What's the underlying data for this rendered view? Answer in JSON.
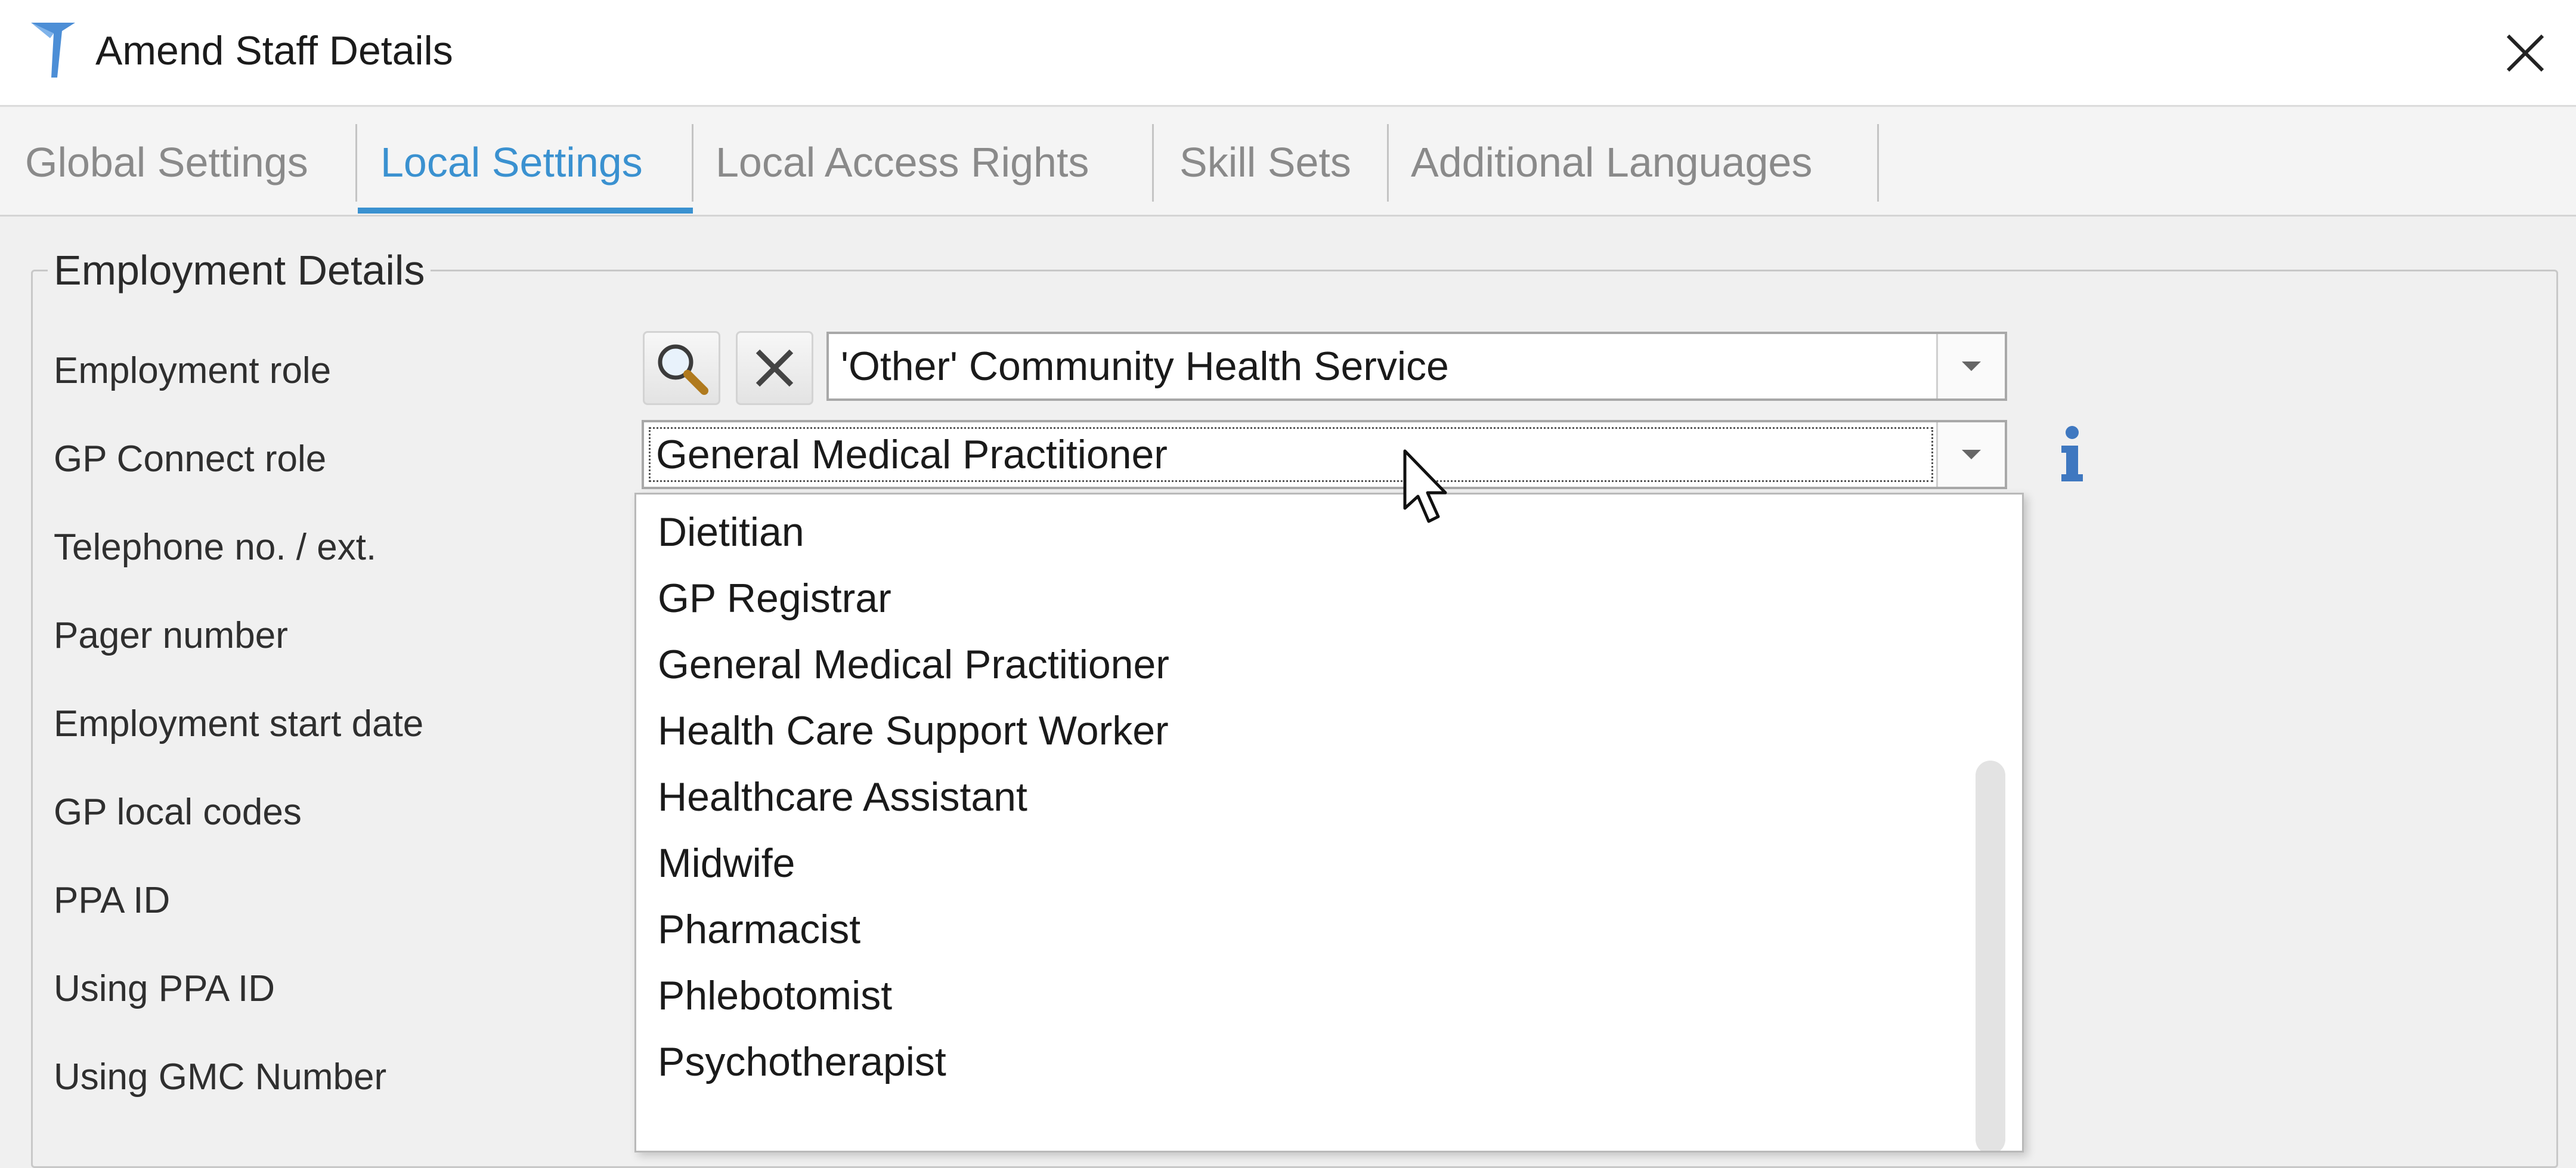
{
  "window": {
    "title": "Amend Staff Details",
    "icon": "app-logo-icon",
    "close_icon": "close-icon"
  },
  "tabs": [
    {
      "label": "Global Settings",
      "active": false
    },
    {
      "label": "Local Settings",
      "active": true
    },
    {
      "label": "Local Access Rights",
      "active": false
    },
    {
      "label": "Skill Sets",
      "active": false
    },
    {
      "label": "Additional Languages",
      "active": false
    }
  ],
  "group": {
    "legend": "Employment Details",
    "labels": [
      "Employment role",
      "GP Connect role",
      "Telephone no. / ext.",
      "Pager number",
      "Employment start date",
      "GP local codes",
      "PPA ID",
      "Using PPA ID",
      "Using GMC Number"
    ]
  },
  "employment_role": {
    "value": "'Other' Community Health Service",
    "search_icon": "search-icon",
    "clear_icon": "clear-icon"
  },
  "gp_connect_role": {
    "value": "General Medical Practitioner",
    "info_icon": "info-icon"
  },
  "dropdown": {
    "options": [
      "Dietitian",
      "GP Registrar",
      "General Medical Practitioner",
      "Health Care Support Worker",
      "Healthcare Assistant",
      "Midwife",
      "Pharmacist",
      "Phlebotomist",
      "Psychotherapist"
    ]
  },
  "colors": {
    "accent": "#3a91d0",
    "background": "#f0f0f0",
    "info": "#3f78c0"
  }
}
